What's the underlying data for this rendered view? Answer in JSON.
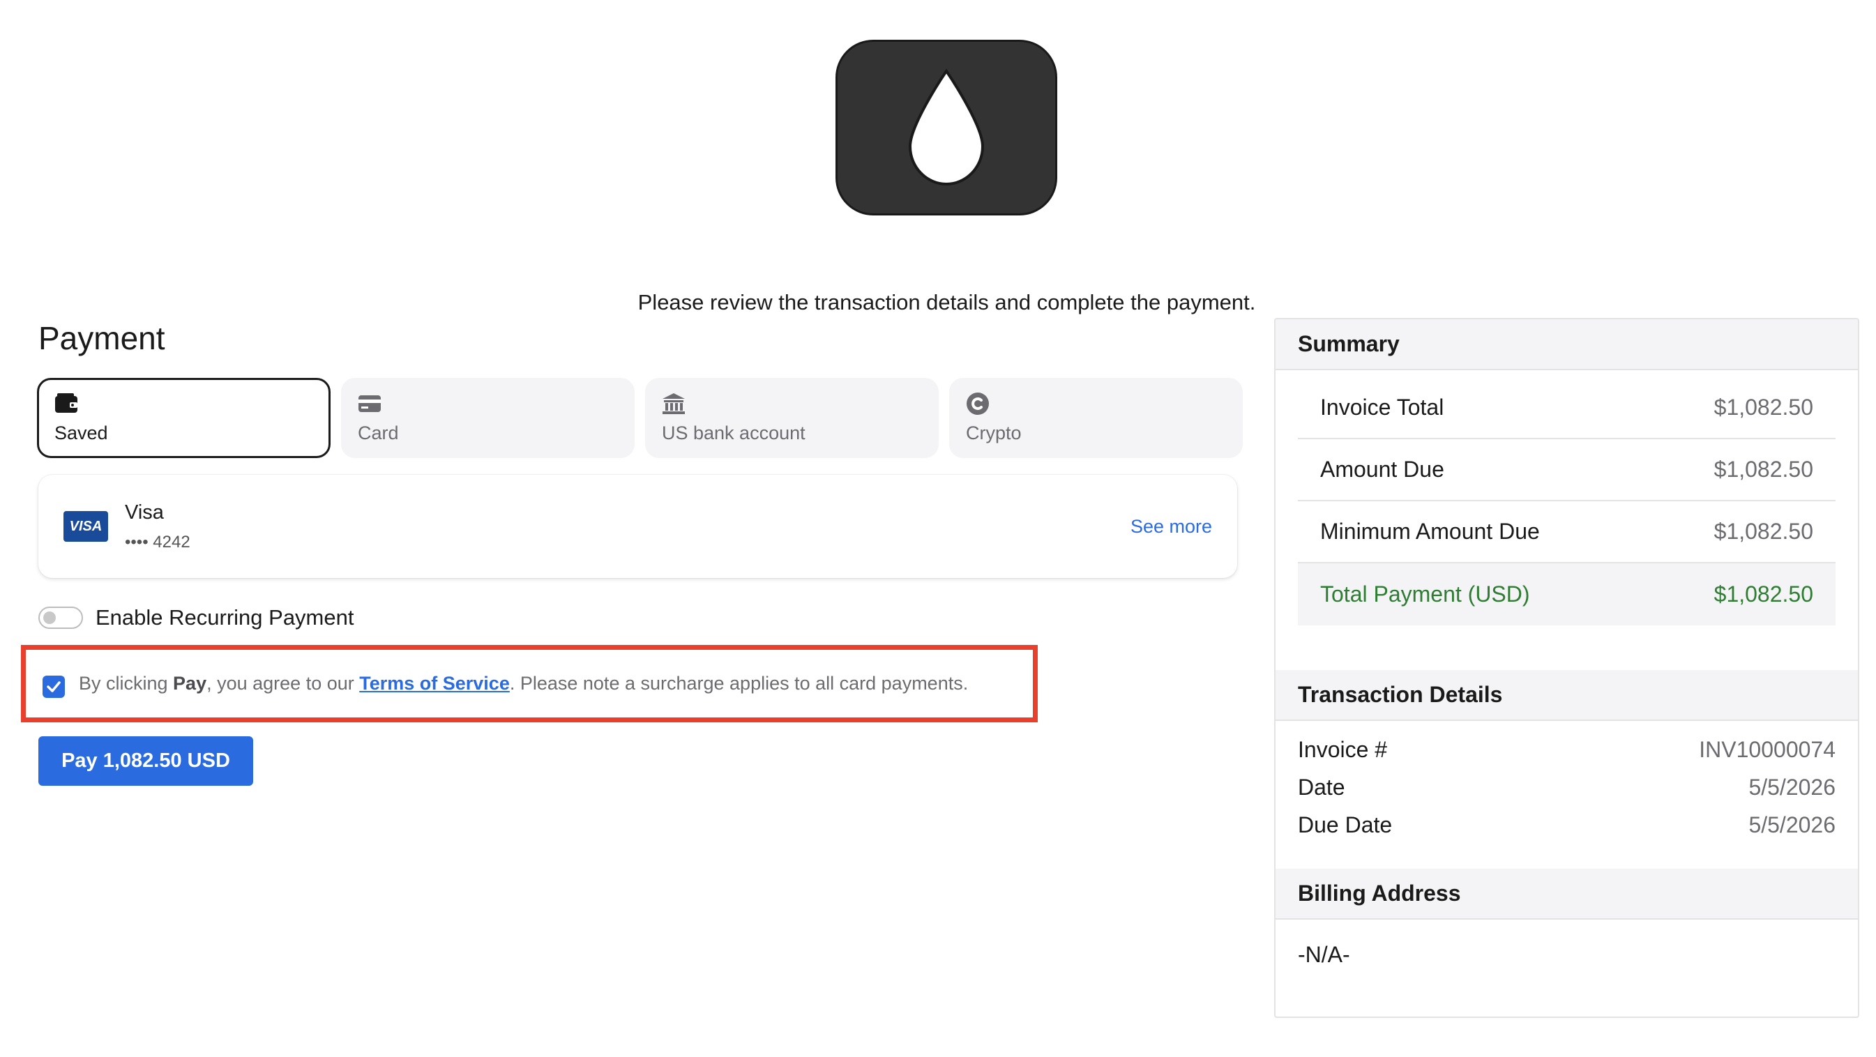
{
  "brand": {
    "logo_icon": "water-drop-icon"
  },
  "intro_text": "Please review the transaction details and complete the payment.",
  "payment": {
    "title": "Payment",
    "tabs": [
      {
        "label": "Saved",
        "icon": "wallet-icon",
        "active": true
      },
      {
        "label": "Card",
        "icon": "credit-card-icon",
        "active": false
      },
      {
        "label": "US bank account",
        "icon": "bank-icon",
        "active": false
      },
      {
        "label": "Crypto",
        "icon": "crypto-coin-icon",
        "active": false
      }
    ],
    "saved_method": {
      "badge": "VISA",
      "brand": "Visa",
      "number": "•••• 4242",
      "see_more": "See more"
    },
    "recurring_label": "Enable Recurring Payment",
    "recurring_enabled": false,
    "consent": {
      "checked": true,
      "prefix": "By clicking ",
      "pay_word": "Pay",
      "middle": ", you agree to our ",
      "tos_link": "Terms of Service",
      "suffix": ". Please note a surcharge applies to all card payments."
    },
    "pay_button": "Pay 1,082.50 USD"
  },
  "summary": {
    "title": "Summary",
    "rows": [
      {
        "label": "Invoice Total",
        "value": "$1,082.50"
      },
      {
        "label": "Amount Due",
        "value": "$1,082.50"
      },
      {
        "label": "Minimum Amount Due",
        "value": "$1,082.50"
      }
    ],
    "total": {
      "label": "Total Payment (USD)",
      "value": "$1,082.50"
    }
  },
  "transaction": {
    "title": "Transaction Details",
    "rows": [
      {
        "label": "Invoice #",
        "value": "INV10000074"
      },
      {
        "label": "Date",
        "value": "5/5/2026"
      },
      {
        "label": "Due Date",
        "value": "5/5/2026"
      }
    ]
  },
  "billing": {
    "title": "Billing Address",
    "value": "-N/A-"
  },
  "colors": {
    "accent": "#2b6be0",
    "total_green": "#2e7d32",
    "highlight_red": "#e8402c",
    "logo_bg": "#333333"
  }
}
